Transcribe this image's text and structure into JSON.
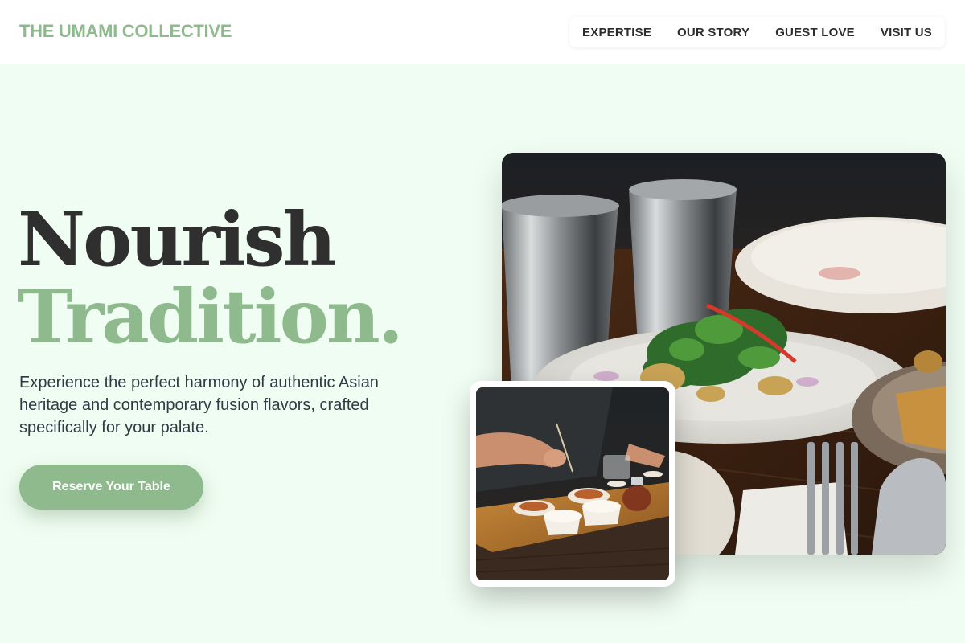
{
  "header": {
    "brand": "THE UMAMI COLLECTIVE",
    "nav": [
      "EXPERTISE",
      "OUR STORY",
      "GUEST LOVE",
      "VISIT US"
    ]
  },
  "hero": {
    "headline_line1": "Nourish",
    "headline_line2": "Tradition.",
    "description": "Experience the perfect harmony of authentic Asian heritage and contemporary fusion flavors, crafted specifically for your palate.",
    "cta_label": "Reserve Your Table"
  },
  "images": {
    "main": "salad-plate-photo",
    "secondary": "chef-plating-photo"
  },
  "colors": {
    "accent": "#8fba8e",
    "background": "#f0fdf2",
    "heading": "#2f2f2f",
    "body_text": "#2f3a44"
  }
}
